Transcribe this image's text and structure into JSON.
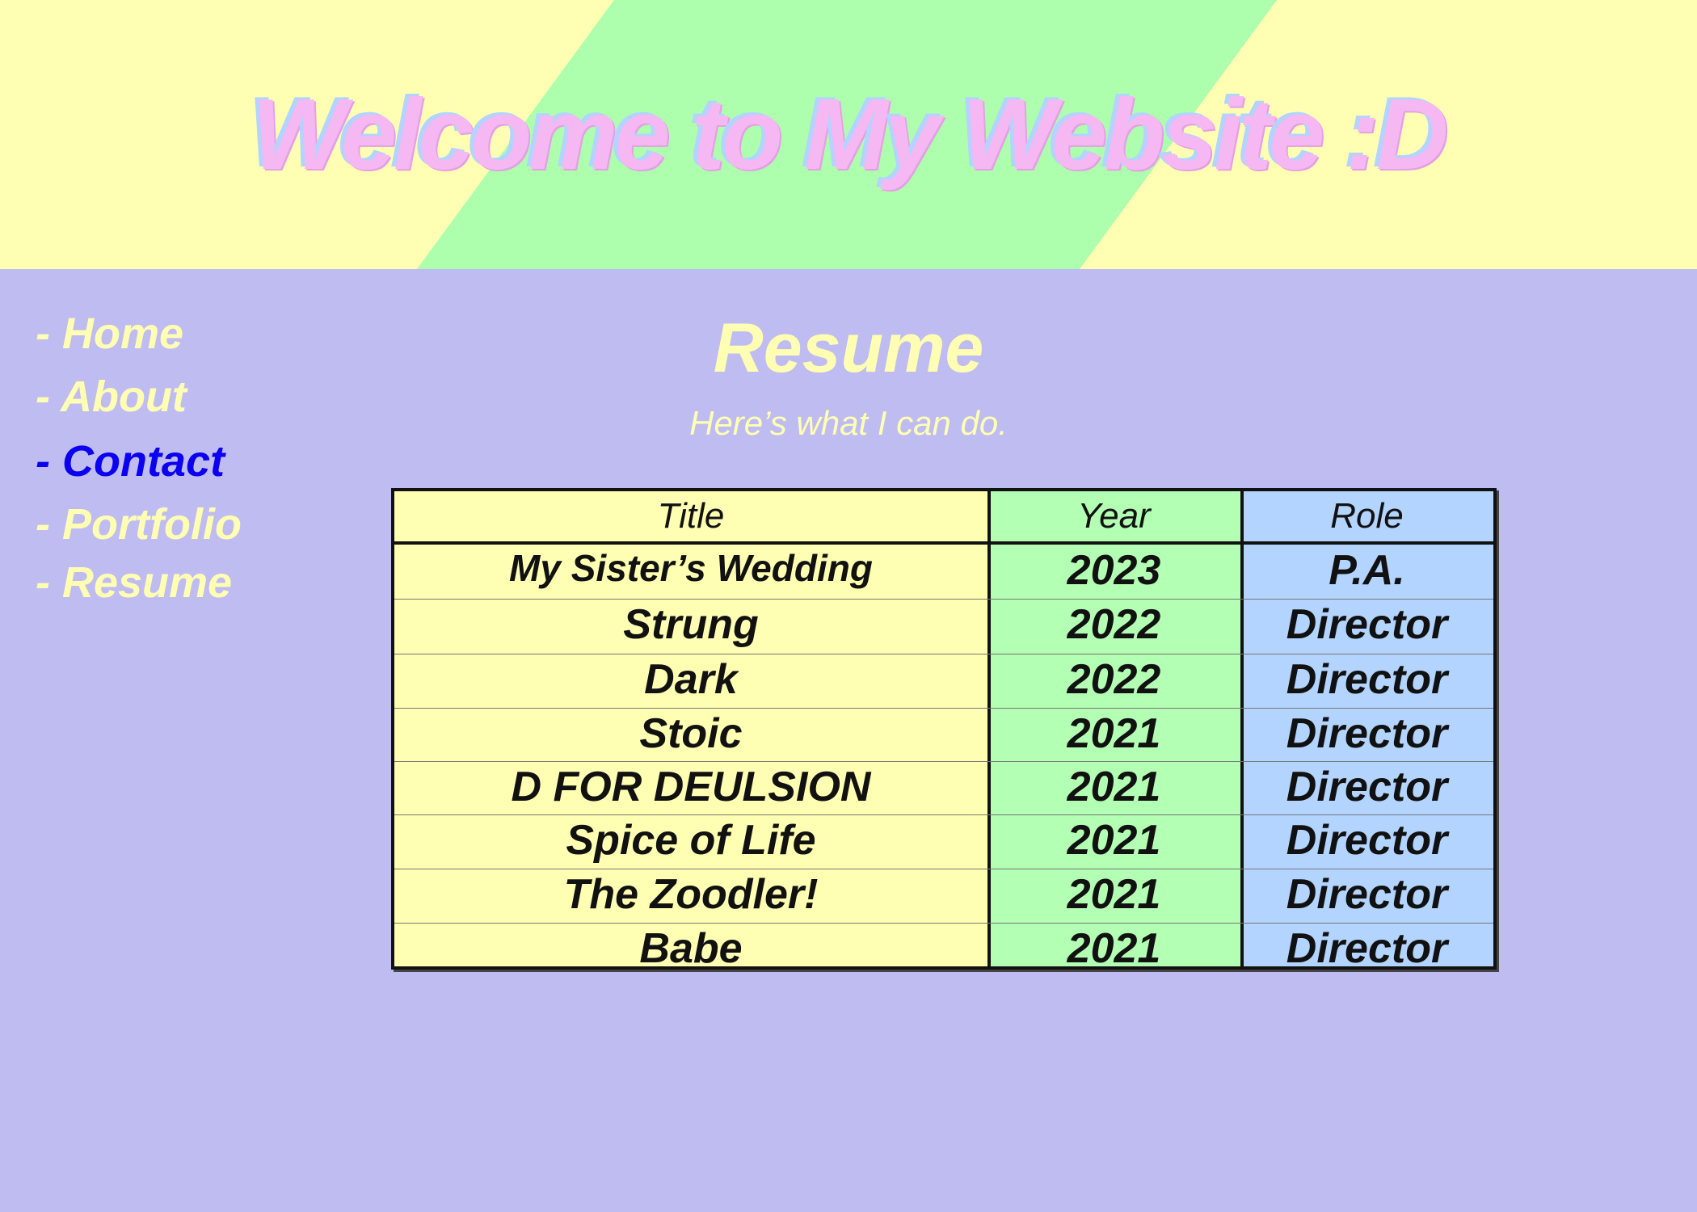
{
  "site": {
    "title": "Welcome to My Website :D"
  },
  "nav": {
    "items": [
      {
        "label": "- Home",
        "active": false
      },
      {
        "label": "- About",
        "active": false
      },
      {
        "label": "- Contact",
        "active": true
      },
      {
        "label": "- Portfolio",
        "active": false
      },
      {
        "label": "- Resume",
        "active": false
      }
    ]
  },
  "page": {
    "heading": "Resume",
    "subtitle": "Here’s what I can do."
  },
  "table": {
    "headers": [
      "Title",
      "Year",
      "Role"
    ],
    "rows": [
      [
        "My Sister’s Wedding",
        "2023",
        "P.A."
      ],
      [
        "Strung",
        "2022",
        "Director"
      ],
      [
        "Dark",
        "2022",
        "Director"
      ],
      [
        "Stoic",
        "2021",
        "Director"
      ],
      [
        "D FOR DEULSION",
        "2021",
        "Director"
      ],
      [
        "Spice of Life",
        "2021",
        "Director"
      ],
      [
        "The Zoodler!",
        "2021",
        "Director"
      ],
      [
        "Babe",
        "2021",
        "Director"
      ]
    ]
  },
  "colors": {
    "background": "#bfbcf2",
    "header_yellow": "#ffffb3",
    "header_green": "#adffad",
    "title_pink": "#f5b8f2",
    "nav_text": "#ffffb3",
    "nav_active": "#0b00f0",
    "col_title_bg": "#ffffb3",
    "col_year_bg": "#b3ffb3",
    "col_role_bg": "#b2d4ff"
  }
}
